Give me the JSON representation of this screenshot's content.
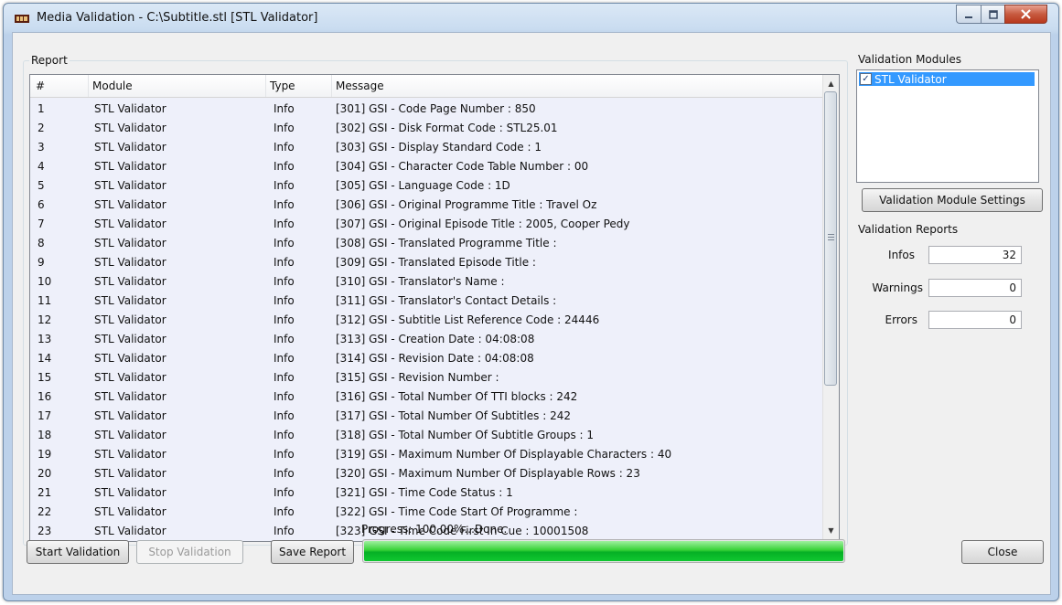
{
  "window": {
    "title": "Media Validation - C:\\Subtitle.stl [STL Validator]",
    "controls": {
      "minimize": "minimize-icon",
      "maximize": "maximize-icon",
      "close": "close-icon"
    }
  },
  "report": {
    "group_label": "Report",
    "columns": [
      "#",
      "Module",
      "Type",
      "Message"
    ],
    "rows": [
      {
        "n": "1",
        "module": "STL Validator",
        "type": "Info",
        "message": "[301] GSI - Code Page Number : 850"
      },
      {
        "n": "2",
        "module": "STL Validator",
        "type": "Info",
        "message": "[302] GSI - Disk Format Code : STL25.01"
      },
      {
        "n": "3",
        "module": "STL Validator",
        "type": "Info",
        "message": "[303] GSI - Display Standard Code : 1"
      },
      {
        "n": "4",
        "module": "STL Validator",
        "type": "Info",
        "message": "[304] GSI - Character Code Table Number : 00"
      },
      {
        "n": "5",
        "module": "STL Validator",
        "type": "Info",
        "message": "[305] GSI - Language Code : 1D"
      },
      {
        "n": "6",
        "module": "STL Validator",
        "type": "Info",
        "message": "[306] GSI - Original Programme Title : Travel Oz"
      },
      {
        "n": "7",
        "module": "STL Validator",
        "type": "Info",
        "message": "[307] GSI - Original Episode Title : 2005, Cooper Pedy"
      },
      {
        "n": "8",
        "module": "STL Validator",
        "type": "Info",
        "message": "[308] GSI - Translated Programme Title :"
      },
      {
        "n": "9",
        "module": "STL Validator",
        "type": "Info",
        "message": "[309] GSI - Translated Episode Title :"
      },
      {
        "n": "10",
        "module": "STL Validator",
        "type": "Info",
        "message": "[310] GSI - Translator's Name :"
      },
      {
        "n": "11",
        "module": "STL Validator",
        "type": "Info",
        "message": "[311] GSI - Translator's Contact Details :"
      },
      {
        "n": "12",
        "module": "STL Validator",
        "type": "Info",
        "message": "[312] GSI - Subtitle List Reference Code : 24446"
      },
      {
        "n": "13",
        "module": "STL Validator",
        "type": "Info",
        "message": "[313] GSI - Creation Date : 04:08:08"
      },
      {
        "n": "14",
        "module": "STL Validator",
        "type": "Info",
        "message": "[314] GSI - Revision Date : 04:08:08"
      },
      {
        "n": "15",
        "module": "STL Validator",
        "type": "Info",
        "message": "[315] GSI - Revision Number :"
      },
      {
        "n": "16",
        "module": "STL Validator",
        "type": "Info",
        "message": "[316] GSI - Total Number Of TTI blocks : 242"
      },
      {
        "n": "17",
        "module": "STL Validator",
        "type": "Info",
        "message": "[317] GSI - Total Number Of Subtitles : 242"
      },
      {
        "n": "18",
        "module": "STL Validator",
        "type": "Info",
        "message": "[318] GSI - Total Number Of Subtitle Groups : 1"
      },
      {
        "n": "19",
        "module": "STL Validator",
        "type": "Info",
        "message": "[319] GSI - Maximum Number Of Displayable Characters : 40"
      },
      {
        "n": "20",
        "module": "STL Validator",
        "type": "Info",
        "message": "[320] GSI - Maximum Number Of Displayable Rows : 23"
      },
      {
        "n": "21",
        "module": "STL Validator",
        "type": "Info",
        "message": "[321] GSI - Time Code Status : 1"
      },
      {
        "n": "22",
        "module": "STL Validator",
        "type": "Info",
        "message": "[322] GSI - Time Code Start Of Programme :"
      },
      {
        "n": "23",
        "module": "STL Validator",
        "type": "Info",
        "message": "[323] GSI - Time Code First In Cue : 10001508"
      }
    ]
  },
  "modules": {
    "group_label": "Validation Modules",
    "items": [
      {
        "label": "STL Validator",
        "checked": true
      }
    ],
    "settings_button": "Validation Module Settings"
  },
  "reports": {
    "group_label": "Validation Reports",
    "infos_label": "Infos",
    "infos_value": "32",
    "warnings_label": "Warnings",
    "warnings_value": "0",
    "errors_label": "Errors",
    "errors_value": "0"
  },
  "progress": {
    "label": "Progress: 100.00%...Done.",
    "fraction": 1.0,
    "color": "#06b025"
  },
  "buttons": {
    "start": "Start Validation",
    "stop": "Stop Validation",
    "save": "Save Report",
    "close": "Close"
  }
}
